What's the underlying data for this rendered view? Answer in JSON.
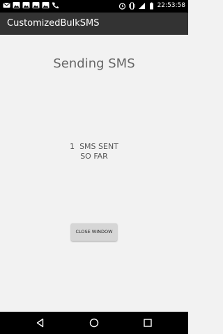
{
  "status_bar": {
    "time": "22:53:58",
    "icons": [
      "mail-icon",
      "gallery-icon",
      "gallery-icon",
      "gallery-icon",
      "gallery-icon",
      "call-icon",
      "alarm-icon",
      "vibrate-icon",
      "signal-icon",
      "battery-icon"
    ]
  },
  "app_bar": {
    "title": "CustomizedBulkSMS"
  },
  "main": {
    "heading": "Sending SMS",
    "sent_line1": "1  SMS SENT",
    "sent_line2": "SO FAR",
    "close_button_label": "CLOSE WINDOW"
  },
  "nav_bar": {
    "icons": [
      "back-icon",
      "home-icon",
      "recents-icon"
    ]
  },
  "colors": {
    "status_bar": "#000000",
    "action_bar": "#333333",
    "background": "#f2f2f2",
    "button": "#d6d6d6"
  }
}
